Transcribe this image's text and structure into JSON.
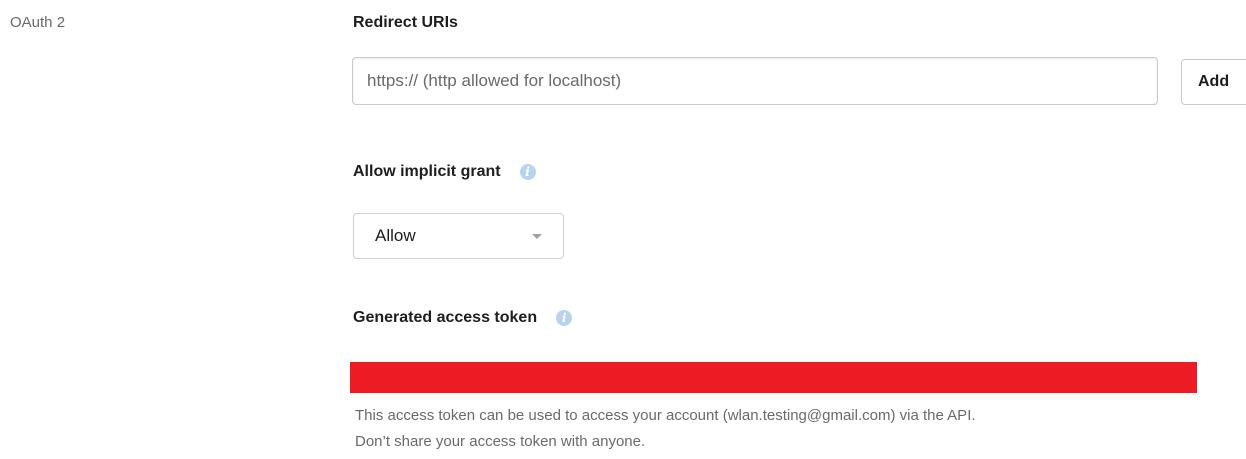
{
  "section": {
    "label": "OAuth 2"
  },
  "redirect": {
    "heading": "Redirect URIs",
    "placeholder": "https:// (http allowed for localhost)",
    "add_label": "Add"
  },
  "implicit_grant": {
    "heading": "Allow implicit grant",
    "selected": "Allow"
  },
  "access_token": {
    "heading": "Generated access token",
    "note_line1": "This access token can be used to access your account (wlan.testing@gmail.com) via the API.",
    "note_line2": "Don’t share your access token with anyone."
  },
  "colors": {
    "redaction": "#ed1c24",
    "info_icon": "#b9d3ee"
  },
  "icons": {
    "info": "info-icon",
    "dropdown": "chevron-down-icon"
  }
}
